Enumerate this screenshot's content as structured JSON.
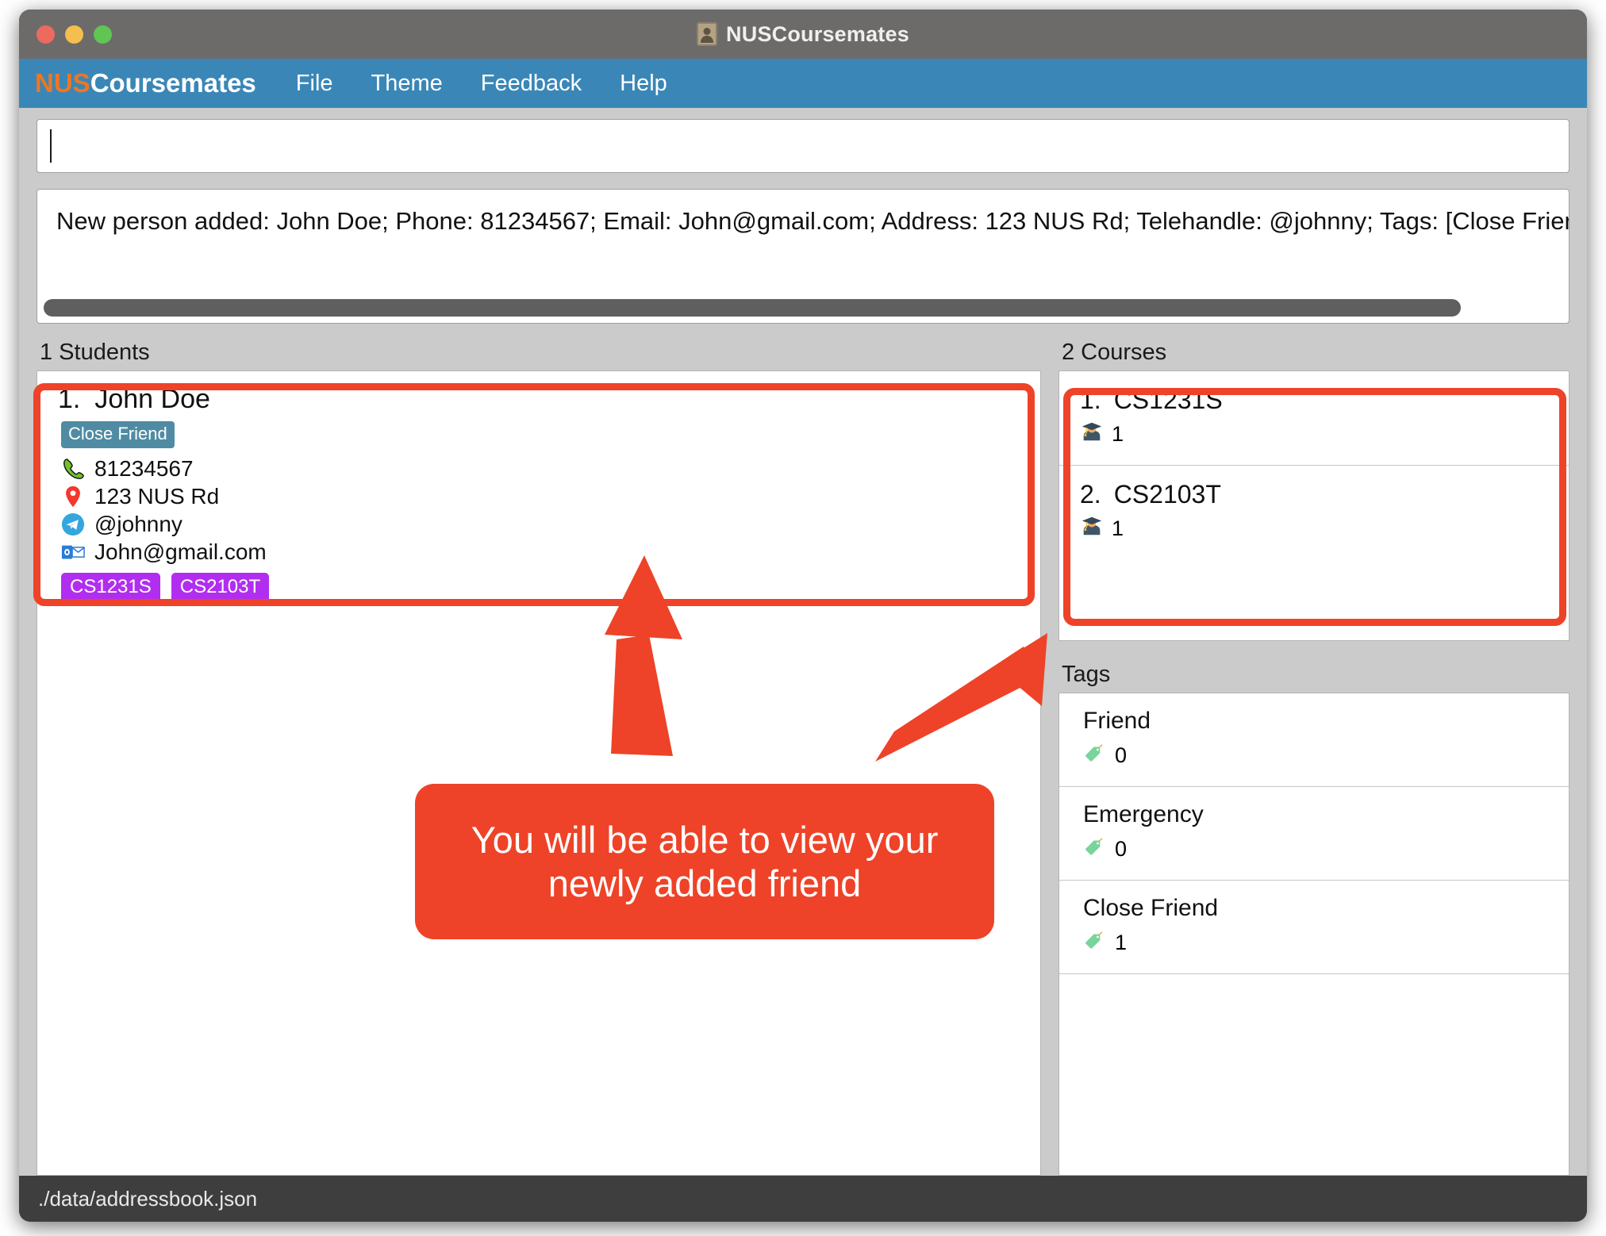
{
  "window": {
    "title": "NUSCoursemates",
    "title_icon": "address-book-icon",
    "traffic_lights": [
      "close",
      "minimize",
      "maximize"
    ]
  },
  "menubar": {
    "brand_prefix": "NUS",
    "brand_suffix": "Coursemates",
    "items": [
      {
        "label": "File"
      },
      {
        "label": "Theme"
      },
      {
        "label": "Feedback"
      },
      {
        "label": "Help"
      }
    ]
  },
  "command_box": {
    "value": "",
    "placeholder": ""
  },
  "result_display": {
    "text": "New person added: John Doe; Phone: 81234567; Email: John@gmail.com; Address: 123 NUS Rd; Telehandle: @johnny; Tags: [Close Friend]",
    "scroll": "horizontal"
  },
  "students_panel": {
    "header": "1 Students",
    "people": [
      {
        "index": "1.",
        "name": "John Doe",
        "tags": [
          "Close Friend"
        ],
        "phone": "81234567",
        "phone_icon": "phone-icon",
        "address": "123 NUS Rd",
        "address_icon": "location-pin-icon",
        "telehandle": "@johnny",
        "telehandle_icon": "telegram-icon",
        "email": "John@gmail.com",
        "email_icon": "outlook-mail-icon",
        "courses": [
          "CS1231S",
          "CS2103T"
        ]
      }
    ]
  },
  "courses_panel": {
    "header": "2 Courses",
    "courses": [
      {
        "index": "1.",
        "code": "CS1231S",
        "student_count": "1",
        "icon": "graduate-icon"
      },
      {
        "index": "2.",
        "code": "CS2103T",
        "student_count": "1",
        "icon": "graduate-icon"
      }
    ]
  },
  "tags_panel": {
    "header": "Tags",
    "tags": [
      {
        "name": "Friend",
        "count": "0",
        "icon": "tag-icon"
      },
      {
        "name": "Emergency",
        "count": "0",
        "icon": "tag-icon"
      },
      {
        "name": "Close Friend",
        "count": "1",
        "icon": "tag-icon"
      }
    ]
  },
  "statusbar": {
    "path": "./data/addressbook.json"
  },
  "annotations": {
    "callout_text": "You will be able to view your newly added friend",
    "accent_color": "#EE4328",
    "arrows": [
      {
        "name": "arrow-to-student-card"
      },
      {
        "name": "arrow-to-courses-panel"
      }
    ]
  },
  "colors": {
    "menubar": "#3A87B7",
    "brand_orange": "#EF7622",
    "tag_chip": "#4F8CA3",
    "course_chip": "#B12EF0",
    "accent": "#EE4328",
    "titlebar": "#6D6B6A",
    "statusbar": "#3E3E3E",
    "body": "#CBCBCB"
  }
}
